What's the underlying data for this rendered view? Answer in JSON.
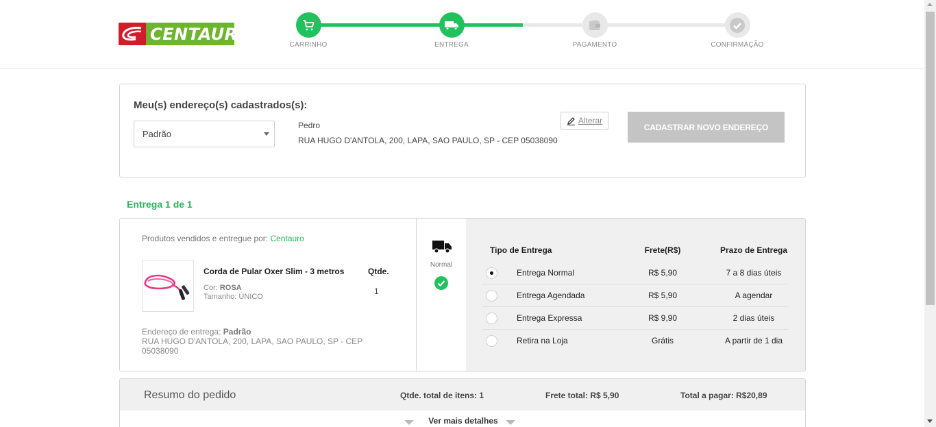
{
  "brand": {
    "name": "CENTAURO"
  },
  "steps": [
    {
      "label": "CARRINHO",
      "status": "done",
      "icon": "cart-icon"
    },
    {
      "label": "ENTREGA",
      "status": "done",
      "icon": "truck-icon"
    },
    {
      "label": "PAGAMENTO",
      "status": "pending",
      "icon": "wallet-icon"
    },
    {
      "label": "CONFIRMAÇÃO",
      "status": "pending",
      "icon": "check-icon"
    }
  ],
  "colors": {
    "accent": "#21c25e",
    "brand_green": "#6cb52d",
    "brand_red": "#cf1d2a",
    "disabled": "#c4c4c4"
  },
  "addresses": {
    "title": "Meu(s) endereço(s) cadastrados(s):",
    "selected": "Padrão",
    "recipient": "Pedro",
    "line": "RUA HUGO D'ANTOLA, 200, LAPA, SAO PAULO, SP - CEP 05038090",
    "edit_label": "Alterar",
    "new_address_label": "CADASTRAR NOVO ENDEREÇO"
  },
  "delivery": {
    "title": "Entrega 1 de 1",
    "sold_by_label": "Produtos vendidos e entregue por:",
    "seller": "Centauro",
    "product": {
      "name": "Corda de Pular Oxer Slim - 3 metros",
      "color_label": "Cor:",
      "color": "ROSA",
      "size_label": "Tamanho:",
      "size": "ÚNICO",
      "qty_label": "Qtde.",
      "qty": "1"
    },
    "ship_label": "Endereço de entrega:",
    "ship_name": "Padrão",
    "ship_line": "RUA HUGO D'ANTOLA, 200, LAPA, SAO PAULO, SP - CEP 05038090",
    "mode_label": "Normal",
    "options_header": {
      "type": "Tipo de Entrega",
      "price": "Frete(R$)",
      "term": "Prazo de Entrega"
    },
    "options": [
      {
        "name": "Entrega Normal",
        "price": "R$ 5,90",
        "term": "7 a 8 dias úteis",
        "selected": true
      },
      {
        "name": "Entrega Agendada",
        "price": "R$ 5,90",
        "term": "A agendar",
        "selected": false
      },
      {
        "name": "Entrega Expressa",
        "price": "R$ 9,90",
        "term": "2 dias úteis",
        "selected": false
      },
      {
        "name": "Retira na Loja",
        "price": "Grátis",
        "term": "A partir de 1 dia",
        "selected": false
      }
    ]
  },
  "summary": {
    "title": "Resumo do pedido",
    "items": "Qtde. total de itens: 1",
    "shipping": "Frete total: R$ 5,90",
    "total": "Total a pagar: R$20,89",
    "more_label": "Ver mais detalhes"
  }
}
